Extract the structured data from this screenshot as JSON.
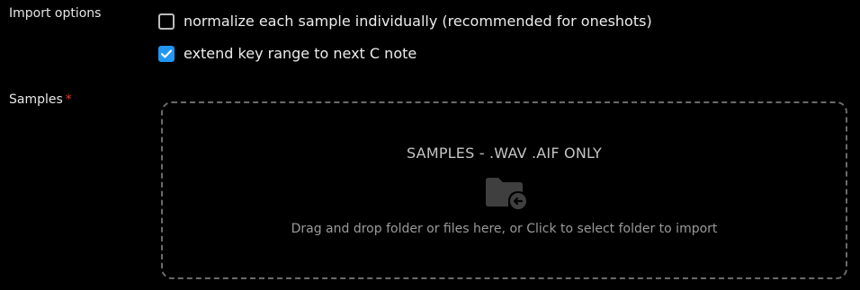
{
  "import_options": {
    "label": "Import options",
    "options": [
      {
        "text": "normalize each sample individually (recommended for oneshots)",
        "checked": false
      },
      {
        "text": "extend key range to next C note",
        "checked": true
      }
    ]
  },
  "samples": {
    "label": "Samples",
    "required_mark": "*",
    "dropzone": {
      "title": "SAMPLES - .WAV .AIF ONLY",
      "icon": "folder-import-icon",
      "hint": "Drag and drop folder or files here, or Click to select folder to import"
    }
  },
  "colors": {
    "background": "#000000",
    "accent": "#2196f3",
    "required": "#e53935"
  }
}
